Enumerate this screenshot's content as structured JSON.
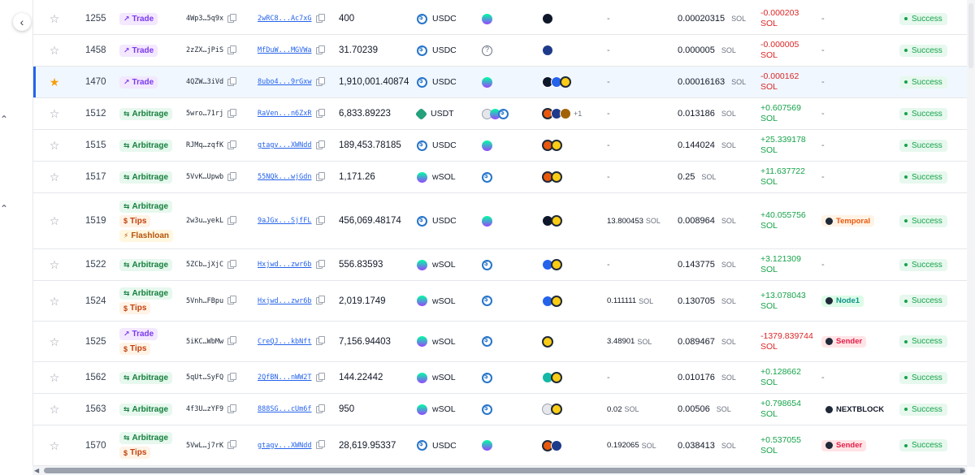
{
  "nav": {
    "collapse_glyph": "‹",
    "chevrons": [
      "⌃",
      "⌃"
    ]
  },
  "rows": [
    {
      "slot": "1255",
      "starred": false,
      "types": [
        "Trade"
      ],
      "sig": "4Wp3…5q9x",
      "acct": "2wRC8...Ac7xG",
      "amount": "400",
      "token": "USDC",
      "token_icon": "wsol",
      "progs": [
        "dark"
      ],
      "tip": "-",
      "tip_unit": "",
      "fee": "0.00020315",
      "fee_unit": "SOL",
      "pnl": "-0.000203",
      "pnl_unit": "SOL",
      "pnl_sign": "neg",
      "provider": "-",
      "provider_style": "",
      "status": "Success"
    },
    {
      "slot": "1458",
      "starred": false,
      "types": [
        "Trade"
      ],
      "sig": "2zZX…jPiS",
      "acct": "MfDuW...MGVWa",
      "amount": "31.70239",
      "token": "USDC",
      "token_icon": "unknown",
      "progs": [
        "navy"
      ],
      "tip": "-",
      "tip_unit": "",
      "fee": "0.000005",
      "fee_unit": "SOL",
      "pnl": "-0.000005",
      "pnl_unit": "SOL",
      "pnl_sign": "neg",
      "provider": "-",
      "provider_style": "",
      "status": "Success"
    },
    {
      "slot": "1470",
      "starred": true,
      "highlight": true,
      "types": [
        "Trade"
      ],
      "sig": "4QZW…3iVd",
      "acct": "8ubo4...9rGxw",
      "amount": "1,910,001.40874",
      "token": "USDC",
      "token_icon": "wsol",
      "progs": [
        "dark",
        "blue",
        "gold"
      ],
      "tip": "-",
      "tip_unit": "",
      "fee": "0.00016163",
      "fee_unit": "SOL",
      "pnl": "-0.000162",
      "pnl_unit": "SOL",
      "pnl_sign": "neg",
      "provider": "-",
      "provider_style": "",
      "status": "Success"
    },
    {
      "slot": "1512",
      "starred": false,
      "types": [
        "Arbitrage"
      ],
      "sig": "5wro…71rj",
      "acct": "RaVen...n6ZxR",
      "amount": "6,833.89223",
      "token": "USDT",
      "token_icon": "multi",
      "progs": [
        "orange",
        "navy",
        "brown"
      ],
      "more": "+1",
      "tip": "-",
      "tip_unit": "",
      "fee": "0.013186",
      "fee_unit": "SOL",
      "pnl": "+0.607569",
      "pnl_unit": "SOL",
      "pnl_sign": "pos",
      "provider": "-",
      "provider_style": "",
      "status": "Success"
    },
    {
      "slot": "1515",
      "starred": false,
      "types": [
        "Arbitrage"
      ],
      "sig": "RJMq…zqfK",
      "acct": "gtagv...XWNdd",
      "amount": "189,453.78185",
      "token": "USDC",
      "token_icon": "wsol",
      "progs": [
        "orange",
        "gold"
      ],
      "tip": "-",
      "tip_unit": "",
      "fee": "0.144024",
      "fee_unit": "SOL",
      "pnl": "+25.339178",
      "pnl_unit": "SOL",
      "pnl_sign": "pos",
      "provider": "-",
      "provider_style": "",
      "status": "Success"
    },
    {
      "slot": "1517",
      "starred": false,
      "types": [
        "Arbitrage"
      ],
      "sig": "5VvK…Upwb",
      "acct": "55NQk...wjGdn",
      "amount": "1,171.26",
      "token": "wSOL",
      "token_icon": "usdc",
      "progs": [
        "orange",
        "gold"
      ],
      "tip": "-",
      "tip_unit": "",
      "fee": "0.25",
      "fee_unit": "SOL",
      "pnl": "+11.637722",
      "pnl_unit": "SOL",
      "pnl_sign": "pos",
      "provider": "-",
      "provider_style": "",
      "status": "Success"
    },
    {
      "slot": "1519",
      "starred": false,
      "types": [
        "Arbitrage",
        "Tips",
        "Flashloan"
      ],
      "sig": "2w3u…yekL",
      "acct": "9aJGx...SjfFL",
      "amount": "456,069.48174",
      "token": "USDC",
      "token_icon": "wsol",
      "progs": [
        "dark",
        "gold"
      ],
      "tip": "13.800453",
      "tip_unit": "SOL",
      "fee": "0.008964",
      "fee_unit": "SOL",
      "pnl": "+40.055756",
      "pnl_unit": "SOL",
      "pnl_sign": "pos",
      "provider": "Temporal",
      "provider_style": "Temporal",
      "status": "Success"
    },
    {
      "slot": "1522",
      "starred": false,
      "types": [
        "Arbitrage"
      ],
      "sig": "5ZCb…jXjC",
      "acct": "Hxjwd...zwr6b",
      "amount": "556.83593",
      "token": "wSOL",
      "token_icon": "usdc",
      "progs": [
        "blue",
        "gold"
      ],
      "tip": "-",
      "tip_unit": "",
      "fee": "0.143775",
      "fee_unit": "SOL",
      "pnl": "+3.121309",
      "pnl_unit": "SOL",
      "pnl_sign": "pos",
      "provider": "-",
      "provider_style": "",
      "status": "Success"
    },
    {
      "slot": "1524",
      "starred": false,
      "types": [
        "Arbitrage",
        "Tips"
      ],
      "sig": "5Vnh…FBpu",
      "acct": "Hxjwd...zwr6b",
      "amount": "2,019.1749",
      "token": "wSOL",
      "token_icon": "usdc",
      "progs": [
        "blue",
        "gold"
      ],
      "tip": "0.111111",
      "tip_unit": "SOL",
      "fee": "0.130705",
      "fee_unit": "SOL",
      "pnl": "+13.078043",
      "pnl_unit": "SOL",
      "pnl_sign": "pos",
      "provider": "Node1",
      "provider_style": "Node1",
      "status": "Success"
    },
    {
      "slot": "1525",
      "starred": false,
      "types": [
        "Trade",
        "Tips"
      ],
      "sig": "5iKC…WbMw",
      "acct": "CreQJ...kbNft",
      "amount": "7,156.94403",
      "token": "wSOL",
      "token_icon": "usdc",
      "progs": [
        "gold"
      ],
      "tip": "3.48901",
      "tip_unit": "SOL",
      "fee": "0.089467",
      "fee_unit": "SOL",
      "pnl": "-1379.839744",
      "pnl_unit": "SOL",
      "pnl_sign": "neg",
      "provider": "Sender",
      "provider_style": "Sender",
      "status": "Success"
    },
    {
      "slot": "1562",
      "starred": false,
      "types": [
        "Arbitrage"
      ],
      "sig": "5qUt…SyFQ",
      "acct": "2QfBN...nWW2T",
      "amount": "144.22442",
      "token": "wSOL",
      "token_icon": "usdc",
      "progs": [
        "teal",
        "gold"
      ],
      "tip": "-",
      "tip_unit": "",
      "fee": "0.010176",
      "fee_unit": "SOL",
      "pnl": "+0.128662",
      "pnl_unit": "SOL",
      "pnl_sign": "pos",
      "provider": "-",
      "provider_style": "",
      "status": "Success"
    },
    {
      "slot": "1563",
      "starred": false,
      "types": [
        "Arbitrage"
      ],
      "sig": "4f3U…zYF9",
      "acct": "888SG...cUm6f",
      "amount": "950",
      "token": "wSOL",
      "token_icon": "usdc",
      "progs": [
        "light",
        "gold"
      ],
      "tip": "0.02",
      "tip_unit": "SOL",
      "fee": "0.00506",
      "fee_unit": "SOL",
      "pnl": "+0.798654",
      "pnl_unit": "SOL",
      "pnl_sign": "pos",
      "provider": "NEXTBLOCK",
      "provider_style": "NEXTBLOCK",
      "status": "Success"
    },
    {
      "slot": "1570",
      "starred": false,
      "types": [
        "Arbitrage",
        "Tips"
      ],
      "sig": "5VwL…j7rK",
      "acct": "gtagv...XWNdd",
      "amount": "28,619.95337",
      "token": "USDC",
      "token_icon": "wsol",
      "progs": [
        "orange",
        "navy"
      ],
      "tip": "0.192065",
      "tip_unit": "SOL",
      "fee": "0.038413",
      "fee_unit": "SOL",
      "pnl": "+0.537055",
      "pnl_unit": "SOL",
      "pnl_sign": "pos",
      "provider": "Sender",
      "provider_style": "Sender",
      "status": "Success"
    }
  ],
  "type_icons": {
    "Trade": "↗",
    "Arbitrage": "⇆",
    "Tips": "$",
    "Flashloan": "⚡"
  },
  "colors": {
    "accent": "#2563eb",
    "success": "#16a34a",
    "negative": "#dc2626",
    "star": "#f59e0b"
  }
}
